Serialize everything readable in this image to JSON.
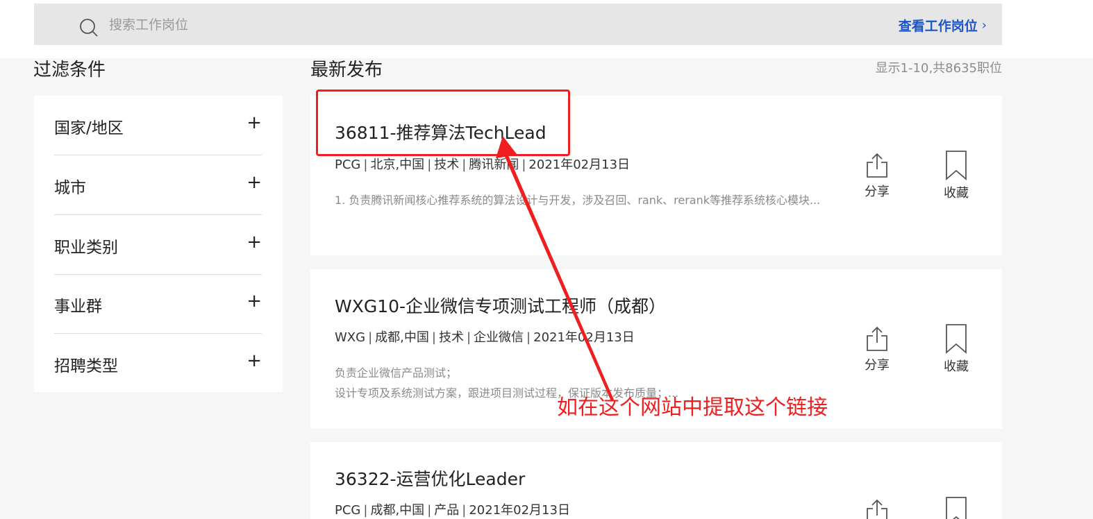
{
  "search": {
    "placeholder": "搜索工作岗位",
    "view_jobs_label": "查看工作岗位",
    "view_jobs_chevron": "›"
  },
  "filters": {
    "title": "过滤条件",
    "items": [
      {
        "label": "国家/地区",
        "toggle": "+"
      },
      {
        "label": "城市",
        "toggle": "+"
      },
      {
        "label": "职业类别",
        "toggle": "+"
      },
      {
        "label": "事业群",
        "toggle": "+"
      },
      {
        "label": "招聘类型",
        "toggle": "+"
      }
    ]
  },
  "listing": {
    "title": "最新发布",
    "count": "显示1-10,共8635职位"
  },
  "jobs": [
    {
      "title": "36811-推荐算法TechLead",
      "meta": [
        "PCG",
        "北京,中国",
        "技术",
        "腾讯新闻",
        "2021年02月13日"
      ],
      "desc": [
        "1. 负责腾讯新闻核心推荐系统的算法设计与开发，涉及召回、rank、rerank等推荐系统核心模块..."
      ]
    },
    {
      "title": "WXG10-企业微信专项测试工程师（成都）",
      "meta": [
        "WXG",
        "成都,中国",
        "技术",
        "企业微信",
        "2021年02月13日"
      ],
      "desc": [
        "负责企业微信产品测试；",
        "设计专项及系统测试方案，跟进项目测试过程，保证版本发布质量；..."
      ]
    },
    {
      "title": "36322-运营优化Leader",
      "meta": [
        "PCG",
        "成都,中国",
        "产品",
        "2021年02月13日"
      ],
      "desc": []
    }
  ],
  "actions": {
    "share_label": "分享",
    "favorite_label": "收藏"
  },
  "annotation": {
    "text": "如在这个网站中提取这个链接",
    "color": "#f01e1e"
  },
  "colors": {
    "accent": "#1c55c9",
    "background": "#f6f6f6"
  }
}
